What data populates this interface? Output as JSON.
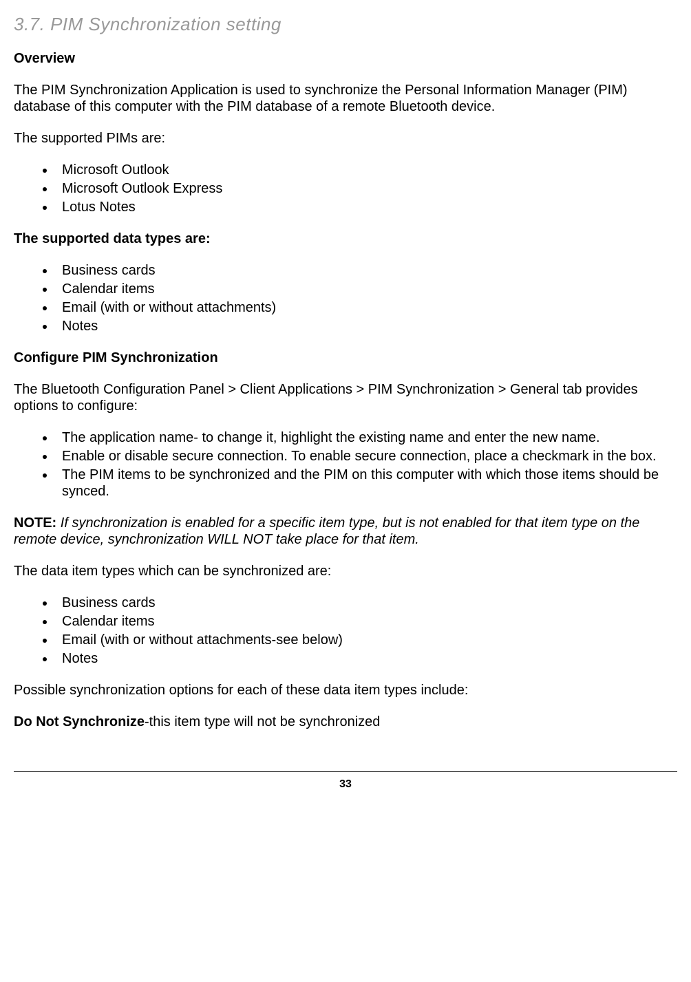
{
  "heading": "3.7. PIM Synchronization setting",
  "overview_label": "Overview",
  "overview_text": "The PIM Synchronization Application is used to synchronize the Personal Information Manager (PIM) database of this computer with the PIM database of a remote Bluetooth device.",
  "supported_pims_intro": "The supported PIMs are:",
  "supported_pims": [
    "Microsoft Outlook",
    "Microsoft Outlook Express",
    "Lotus Notes"
  ],
  "supported_data_types_label": "The supported data types are:",
  "supported_data_types": [
    "Business cards",
    "Calendar items",
    "Email (with or without attachments)",
    "Notes"
  ],
  "configure_label": "Configure PIM Synchronization",
  "configure_text": "The Bluetooth Configuration Panel > Client Applications > PIM Synchronization > General tab provides options to configure:",
  "configure_options": [
    "The application name- to change it, highlight the existing name and enter the new name.",
    "Enable or disable secure connection. To enable secure connection, place a checkmark in the box.",
    "The PIM items to be synchronized and the PIM on this computer with which those items should be synced."
  ],
  "note_label": "NOTE:",
  "note_text": " If synchronization is enabled for a specific item type, but is not enabled for that item type on the remote device, synchronization WILL NOT take place for that item.",
  "sync_types_intro": "The data item types which can be synchronized are:",
  "sync_types": [
    "Business cards",
    "Calendar items",
    "Email (with or without attachments-see below)",
    "Notes"
  ],
  "sync_options_intro": "Possible synchronization options for each of these data item types include:",
  "do_not_sync_label": "Do Not Synchronize",
  "do_not_sync_text": "-this item type will not be synchronized",
  "page_number": "33"
}
